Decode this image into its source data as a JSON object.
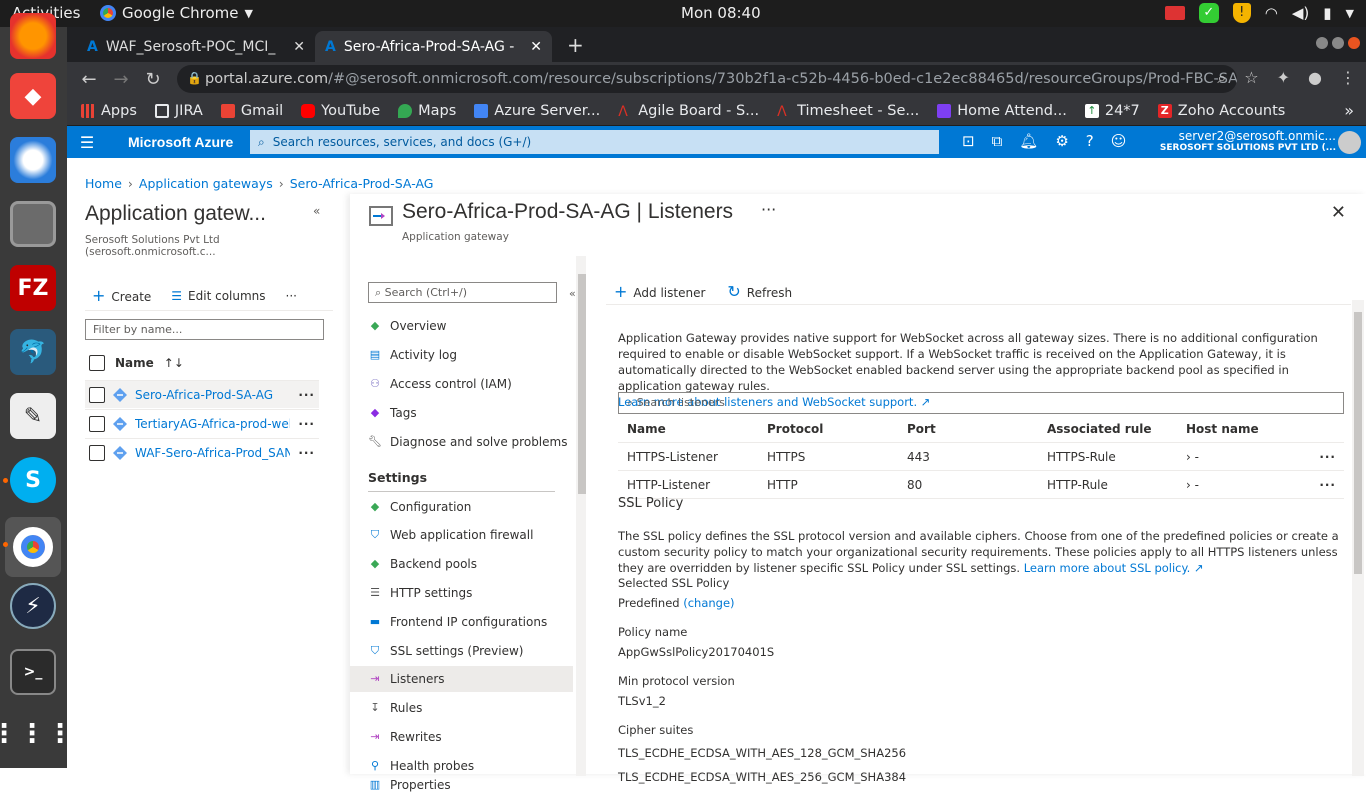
{
  "system": {
    "activities": "Activities",
    "app_name": "Google Chrome",
    "clock": "Mon 08:40"
  },
  "dock": {
    "apps": [
      "firefox-icon",
      "anydesk-icon",
      "thunderbird-icon",
      "files-icon",
      "filezilla-icon",
      "mysql-workbench-icon",
      "text-editor-icon",
      "skype-icon",
      "chrome-icon",
      "zoho-assist-icon",
      "terminal-icon",
      "show-apps-icon"
    ]
  },
  "browser": {
    "tabs": [
      {
        "title": "WAF_Serosoft-POC_MCI_"
      },
      {
        "title": "Sero-Africa-Prod-SA-AG - M"
      }
    ],
    "url_host": "portal.azure.com",
    "url_path": "/#@serosoft.onmicrosoft.com/resource/subscriptions/730b2f1a-c52b-4456-b0ed-c1e2ec88465d/resourceGroups/Prod-FBC-SA-AG/provi...",
    "bookmarks": [
      {
        "label": "Apps",
        "color": "#e94235"
      },
      {
        "label": "JIRA",
        "color": "#5f6368"
      },
      {
        "label": "Gmail",
        "color": "#ea4335"
      },
      {
        "label": "YouTube",
        "color": "#ff0000"
      },
      {
        "label": "Maps",
        "color": "#34a853"
      },
      {
        "label": "Azure Server...",
        "color": "#4285f4"
      },
      {
        "label": "Agile Board - S...",
        "color": "#d93025"
      },
      {
        "label": "Timesheet - Se...",
        "color": "#d93025"
      },
      {
        "label": "Home Attend...",
        "color": "#7e3ff2"
      },
      {
        "label": "24*7",
        "color": "#1e8e3e"
      },
      {
        "label": "Zoho Accounts",
        "color": "#e42527"
      }
    ],
    "more_bookmarks": "»"
  },
  "azure": {
    "brand": "Microsoft Azure",
    "search_placeholder": "Search resources, services, and docs (G+/)",
    "user_email": "server2@serosoft.onmic...",
    "user_tenant": "SEROSOFT SOLUTIONS PVT LTD (..."
  },
  "breadcrumb": [
    "Home",
    "Application gateways",
    "Sero-Africa-Prod-SA-AG"
  ],
  "left_blade": {
    "title": "Application gatew...",
    "subtitle": "Serosoft Solutions Pvt Ltd (serosoft.onmicrosoft.c...",
    "create": "Create",
    "edit_columns": "Edit columns",
    "filter_placeholder": "Filter by name...",
    "col_name": "Name",
    "rows": [
      {
        "name": "Sero-Africa-Prod-SA-AG"
      },
      {
        "name": "TertiaryAG-Africa-prod-web..."
      },
      {
        "name": "WAF-Sero-Africa-Prod_SAN_..."
      }
    ]
  },
  "main_blade": {
    "title": "Sero-Africa-Prod-SA-AG | Listeners",
    "subtitle": "Application gateway",
    "menu_search": "Search (Ctrl+/)",
    "menu_top": [
      {
        "label": "Overview",
        "icon": "overview-icon"
      },
      {
        "label": "Activity log",
        "icon": "activity-log-icon"
      },
      {
        "label": "Access control (IAM)",
        "icon": "iam-icon"
      },
      {
        "label": "Tags",
        "icon": "tag-icon"
      },
      {
        "label": "Diagnose and solve problems",
        "icon": "wrench-icon"
      }
    ],
    "settings_label": "Settings",
    "menu_settings": [
      {
        "label": "Configuration",
        "icon": "config-icon"
      },
      {
        "label": "Web application firewall",
        "icon": "shield-icon"
      },
      {
        "label": "Backend pools",
        "icon": "backend-pool-icon"
      },
      {
        "label": "HTTP settings",
        "icon": "http-settings-icon"
      },
      {
        "label": "Frontend IP configurations",
        "icon": "frontend-ip-icon"
      },
      {
        "label": "SSL settings (Preview)",
        "icon": "ssl-icon"
      },
      {
        "label": "Listeners",
        "icon": "listeners-icon"
      },
      {
        "label": "Rules",
        "icon": "rules-icon"
      },
      {
        "label": "Rewrites",
        "icon": "rewrites-icon"
      },
      {
        "label": "Health probes",
        "icon": "health-probe-icon"
      },
      {
        "label": "Properties",
        "icon": "properties-icon"
      }
    ],
    "toolbar": {
      "add": "Add listener",
      "refresh": "Refresh"
    },
    "info_text": "Application Gateway provides native support for WebSocket across all gateway sizes. There is no additional configuration required to enable or disable WebSocket support. If a WebSocket traffic is received on the Application Gateway, it is automatically directed to the WebSocket enabled backend server using the appropriate backend pool as specified in application gateway rules.",
    "info_link": "Learn more about listeners and WebSocket support.",
    "search_listeners": "Search listeners",
    "table": {
      "headers": [
        "Name",
        "Protocol",
        "Port",
        "Associated rule",
        "Host name"
      ],
      "rows": [
        {
          "name": "HTTPS-Listener",
          "protocol": "HTTPS",
          "port": "443",
          "rule": "HTTPS-Rule",
          "host": "-"
        },
        {
          "name": "HTTP-Listener",
          "protocol": "HTTP",
          "port": "80",
          "rule": "HTTP-Rule",
          "host": "-"
        }
      ]
    },
    "ssl": {
      "title": "SSL Policy",
      "desc": "The SSL policy defines the SSL protocol version and available ciphers. Choose from one of the predefined policies or create a custom security policy to match your organizational security requirements. These policies apply to all HTTPS listeners unless they are overridden by listener specific SSL Policy under SSL settings.",
      "desc_link": "Learn more about SSL policy.",
      "selected_label": "Selected SSL Policy",
      "selected_value": "Predefined",
      "change": "(change)",
      "policy_name_label": "Policy name",
      "policy_name": "AppGwSslPolicy20170401S",
      "min_proto_label": "Min protocol version",
      "min_proto": "TLSv1_2",
      "cipher_label": "Cipher suites",
      "ciphers": [
        "TLS_ECDHE_ECDSA_WITH_AES_128_GCM_SHA256",
        "TLS_ECDHE_ECDSA_WITH_AES_256_GCM_SHA384"
      ]
    }
  }
}
